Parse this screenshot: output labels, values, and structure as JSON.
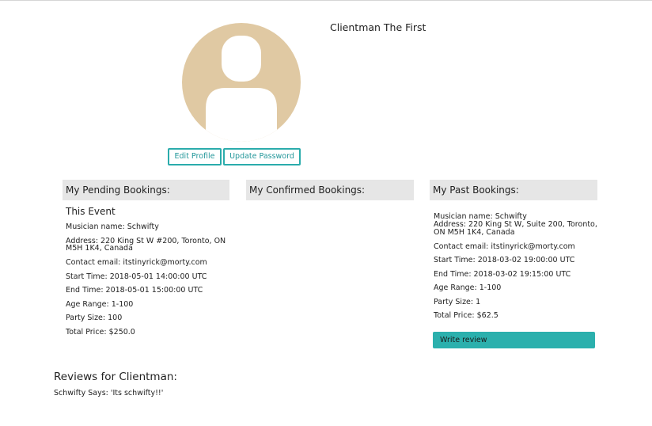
{
  "profile": {
    "name": "Clientman The First",
    "avatar_icon": "user-silhouette-icon",
    "avatar_color": "#e0c9a3",
    "edit_label": "Edit Profile",
    "password_label": "Update Password"
  },
  "pending": {
    "heading": "My Pending Bookings:",
    "event_title": "This Event",
    "musician": "Musician name: Schwifty",
    "address_1": "Address: 220 King St W #200, Toronto, ON",
    "address_2": "M5H 1K4, Canada",
    "email": "Contact email: itstinyrick@morty.com",
    "start": "Start Time: 2018-05-01 14:00:00 UTC",
    "end": "End Time: 2018-05-01 15:00:00 UTC",
    "age": "Age Range: 1-100",
    "party": "Party Size: 100",
    "price": "Total Price: $250.0"
  },
  "confirmed": {
    "heading": "My Confirmed Bookings:"
  },
  "past": {
    "heading": "My Past Bookings:",
    "musician": "Musician name: Schwifty",
    "address_1": "Address: 220 King St W, Suite 200, Toronto,",
    "address_2": "ON M5H 1K4, Canada",
    "email": "Contact email: itstinyrick@morty.com",
    "start": "Start Time: 2018-03-02 19:00:00 UTC",
    "end": "End Time: 2018-03-02 19:15:00 UTC",
    "age": "Age Range: 1-100",
    "party": "Party Size: 1",
    "price": "Total Price: $62.5",
    "review_label": "Write review",
    "accent_color": "#2bb0ad"
  },
  "reviews": {
    "title": "Reviews for Clientman:",
    "items": [
      {
        "text": "Schwifty Says: 'Its schwifty!!'"
      }
    ]
  }
}
